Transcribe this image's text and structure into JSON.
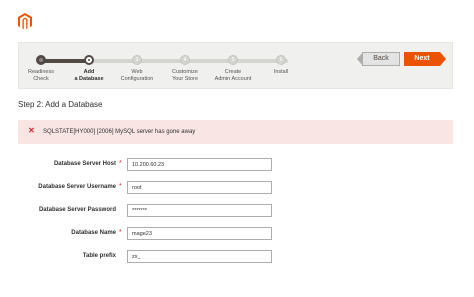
{
  "brand": {
    "logo_icon": "magento-logo-icon",
    "accent": "#eb5202"
  },
  "wizard": {
    "steps": [
      {
        "number": "1",
        "label": "Readiness\nCheck",
        "state": "done"
      },
      {
        "number": "2",
        "label": "Add\na Database",
        "state": "current"
      },
      {
        "number": "3",
        "label": "Web\nConfiguration",
        "state": "pending"
      },
      {
        "number": "4",
        "label": "Customize\nYour Store",
        "state": "pending"
      },
      {
        "number": "5",
        "label": "Create\nAdmin Account",
        "state": "pending"
      },
      {
        "number": "6",
        "label": "Install",
        "state": "pending"
      }
    ],
    "back_label": "Back",
    "next_label": "Next"
  },
  "page": {
    "title": "Step 2: Add a Database"
  },
  "error": {
    "icon": "error-x-icon",
    "message": "SQLSTATE[HY000] [2006] MySQL server has gone away"
  },
  "form": {
    "host": {
      "label": "Database Server Host",
      "value": "10.200.60.23",
      "required": true
    },
    "username": {
      "label": "Database Server Username",
      "value": "root",
      "required": true
    },
    "password": {
      "label": "Database Server Password",
      "value": "*******",
      "required": false
    },
    "name": {
      "label": "Database Name",
      "value": "mage23",
      "required": true
    },
    "prefix": {
      "label": "Table prefix",
      "value": "zx_",
      "required": false
    }
  }
}
